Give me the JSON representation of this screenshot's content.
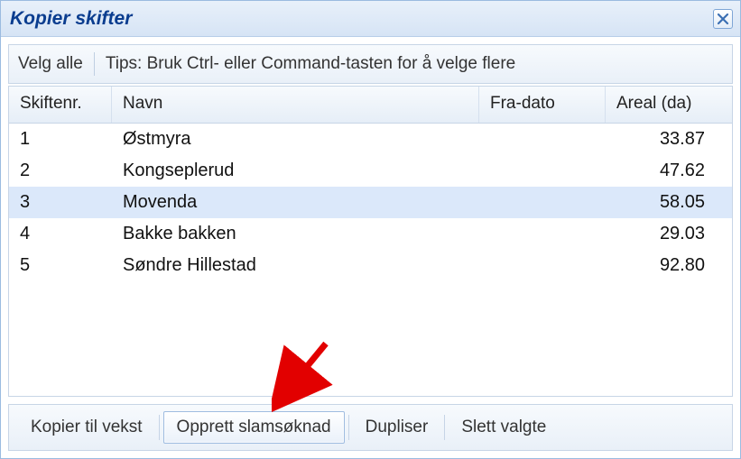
{
  "dialog": {
    "title": "Kopier skifter"
  },
  "toolbar": {
    "select_all": "Velg alle",
    "tip": "Tips: Bruk Ctrl- eller Command-tasten for å velge flere"
  },
  "grid": {
    "headers": {
      "num": "Skiftenr.",
      "name": "Navn",
      "date": "Fra-dato",
      "area": "Areal (da)"
    },
    "rows": [
      {
        "num": "1",
        "name": "Østmyra",
        "date": "",
        "area": "33.87",
        "selected": false
      },
      {
        "num": "2",
        "name": "Kongseplerud",
        "date": "",
        "area": "47.62",
        "selected": false
      },
      {
        "num": "3",
        "name": "Movenda",
        "date": "",
        "area": "58.05",
        "selected": true
      },
      {
        "num": "4",
        "name": "Bakke bakken",
        "date": "",
        "area": "29.03",
        "selected": false
      },
      {
        "num": "5",
        "name": "Søndre Hillestad",
        "date": "",
        "area": "92.80",
        "selected": false
      }
    ]
  },
  "footer": {
    "copy_to_crop": "Kopier til vekst",
    "create_sludge": "Opprett slamsøknad",
    "duplicate": "Dupliser",
    "delete_selected": "Slett valgte"
  }
}
